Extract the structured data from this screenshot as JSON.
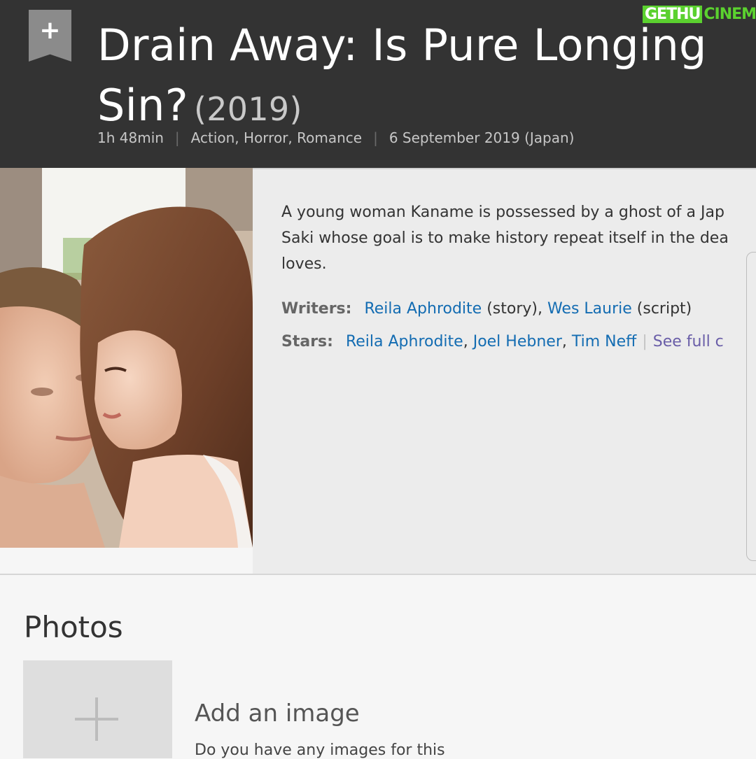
{
  "header": {
    "title_line1": "Drain Away: Is Pure Longing",
    "title_line2": "Sin?",
    "year": "(2019)",
    "runtime": "1h 48min",
    "genres": "Action, Horror, Romance",
    "release": "6 September 2019 (Japan)",
    "separator": "|",
    "watchlist_symbol": "+"
  },
  "brand": {
    "part1": "GETHU",
    "part2": "CINEMA"
  },
  "poster": {
    "icon": "poster-image"
  },
  "summary": "A young woman Kaname is possessed by a ghost of a Jap Saki whose goal is to make history repeat itself in the dea loves.",
  "summary_lines": [
    "A young woman Kaname is possessed by a ghost of a Jap",
    "Saki whose goal is to make history repeat itself in the dea",
    "loves."
  ],
  "writers": {
    "label": "Writers:",
    "people": [
      {
        "name": "Reila Aphrodite",
        "note": " (story),"
      },
      {
        "name": "Wes Laurie",
        "note": " (script)"
      }
    ]
  },
  "stars": {
    "label": "Stars:",
    "people": [
      "Reila Aphrodite",
      "Joel Hebner",
      "Tim Neff"
    ],
    "sep": ",",
    "see_full": "See full c"
  },
  "photos": {
    "title": "Photos",
    "add_title": "Add an image",
    "add_desc": "Do you have any images for this"
  },
  "colors": {
    "header_bg": "#333333",
    "link": "#136cb2",
    "brand": "#5bd12f"
  }
}
